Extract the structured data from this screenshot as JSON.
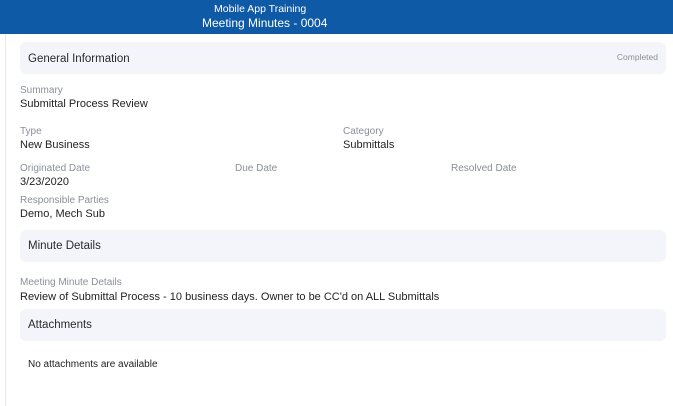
{
  "header": {
    "project": "Mobile App Training",
    "title": "Meeting Minutes - 0004",
    "background_color": "#0e5aa7"
  },
  "general_information": {
    "title": "General Information",
    "status": "Completed",
    "summary_label": "Summary",
    "summary_value": "Submittal Process Review",
    "type_label": "Type",
    "type_value": "New Business",
    "category_label": "Category",
    "category_value": "Submittals",
    "originated_date_label": "Originated Date",
    "originated_date_value": "3/23/2020",
    "due_date_label": "Due Date",
    "due_date_value": "",
    "resolved_date_label": "Resolved Date",
    "resolved_date_value": "",
    "responsible_parties_label": "Responsible Parties",
    "responsible_parties_value": "Demo, Mech Sub"
  },
  "minute_details": {
    "title": "Minute Details",
    "details_label": "Meeting Minute Details",
    "details_value": "Review of Submittal Process - 10 business days. Owner to be CC'd on ALL Submittals"
  },
  "attachments": {
    "title": "Attachments",
    "empty_message": "No attachments are available"
  }
}
